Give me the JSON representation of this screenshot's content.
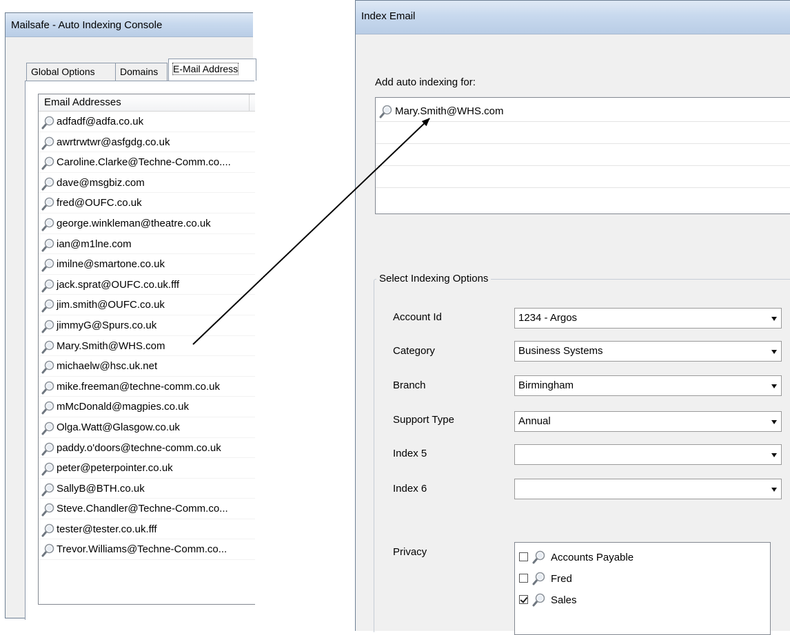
{
  "left_window": {
    "title": "Mailsafe - Auto Indexing Console",
    "tabs": [
      {
        "label": "Global Options"
      },
      {
        "label": "Domains"
      },
      {
        "label": "E-Mail Address"
      }
    ],
    "list": {
      "column_header": "Email Addresses",
      "rows": [
        "adfadf@adfa.co.uk",
        "awrtrwtwr@asfgdg.co.uk",
        "Caroline.Clarke@Techne-Comm.co....",
        "dave@msgbiz.com",
        "fred@OUFC.co.uk",
        "george.winkleman@theatre.co.uk",
        "ian@m1lne.com",
        "imilne@smartone.co.uk",
        "jack.sprat@OUFC.co.uk.fff",
        "jim.smith@OUFC.co.uk",
        "jimmyG@Spurs.co.uk",
        "Mary.Smith@WHS.com",
        "michaelw@hsc.uk.net",
        "mike.freeman@techne-comm.co.uk",
        "mMcDonald@magpies.co.uk",
        "Olga.Watt@Glasgow.co.uk",
        "paddy.o'doors@techne-comm.co.uk",
        "peter@peterpointer.co.uk",
        "SallyB@BTH.co.uk",
        "Steve.Chandler@Techne-Comm.co...",
        "tester@tester.co.uk.fff",
        "Trevor.Williams@Techne-Comm.co..."
      ]
    }
  },
  "right_window": {
    "title": "Index Email",
    "add_label": "Add auto indexing for:",
    "add_items": [
      "Mary.Smith@WHS.com"
    ],
    "options_legend": "Select Indexing Options",
    "fields": [
      {
        "label": "Account Id",
        "value": "1234 - Argos"
      },
      {
        "label": "Category",
        "value": "Business Systems"
      },
      {
        "label": "Branch",
        "value": "Birmingham"
      },
      {
        "label": "Support Type",
        "value": "Annual"
      },
      {
        "label": "Index 5",
        "value": ""
      },
      {
        "label": "Index 6",
        "value": ""
      }
    ],
    "privacy_label": "Privacy",
    "privacy_items": [
      {
        "label": "Accounts Payable",
        "checked": false
      },
      {
        "label": "Fred",
        "checked": false
      },
      {
        "label": "Sales",
        "checked": true
      }
    ]
  },
  "colors": {
    "title_bar": "#c8d9ee",
    "window_bg": "#f0f0f0",
    "search_icon": "#b5bcc4"
  },
  "icons": {
    "list_item": "magnifier-icon",
    "combo_arrow": "chevron-down-icon"
  }
}
